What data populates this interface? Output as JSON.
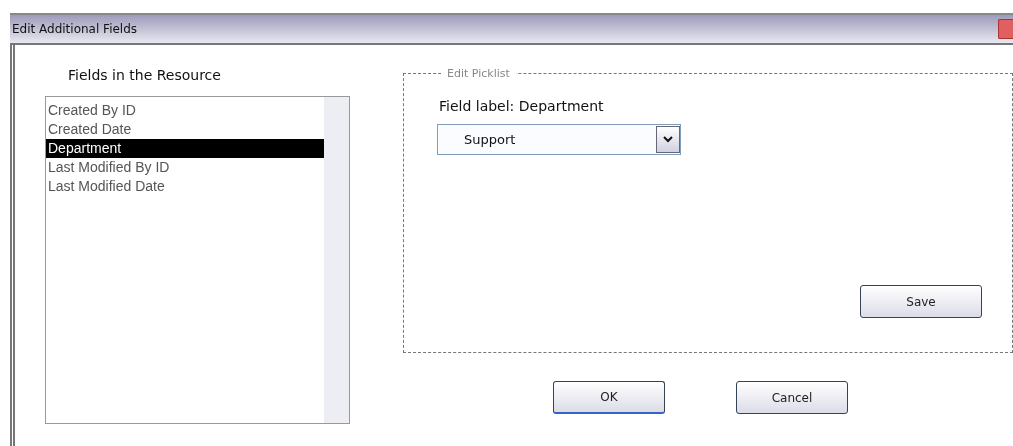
{
  "window": {
    "title": "Edit Additional Fields"
  },
  "fields_list": {
    "heading": "Fields in the Resource",
    "items": [
      {
        "label": "Created By ID",
        "selected": false
      },
      {
        "label": "Created Date",
        "selected": false
      },
      {
        "label": "Department",
        "selected": true
      },
      {
        "label": "Last Modified By ID",
        "selected": false
      },
      {
        "label": "Last Modified Date",
        "selected": false
      }
    ]
  },
  "edit_picklist": {
    "legend": "Edit Picklist",
    "field_label": "Field label: Department",
    "dropdown": {
      "value": "Support"
    },
    "save_button": "Save"
  },
  "buttons": [
    "OK",
    "Cancel"
  ]
}
